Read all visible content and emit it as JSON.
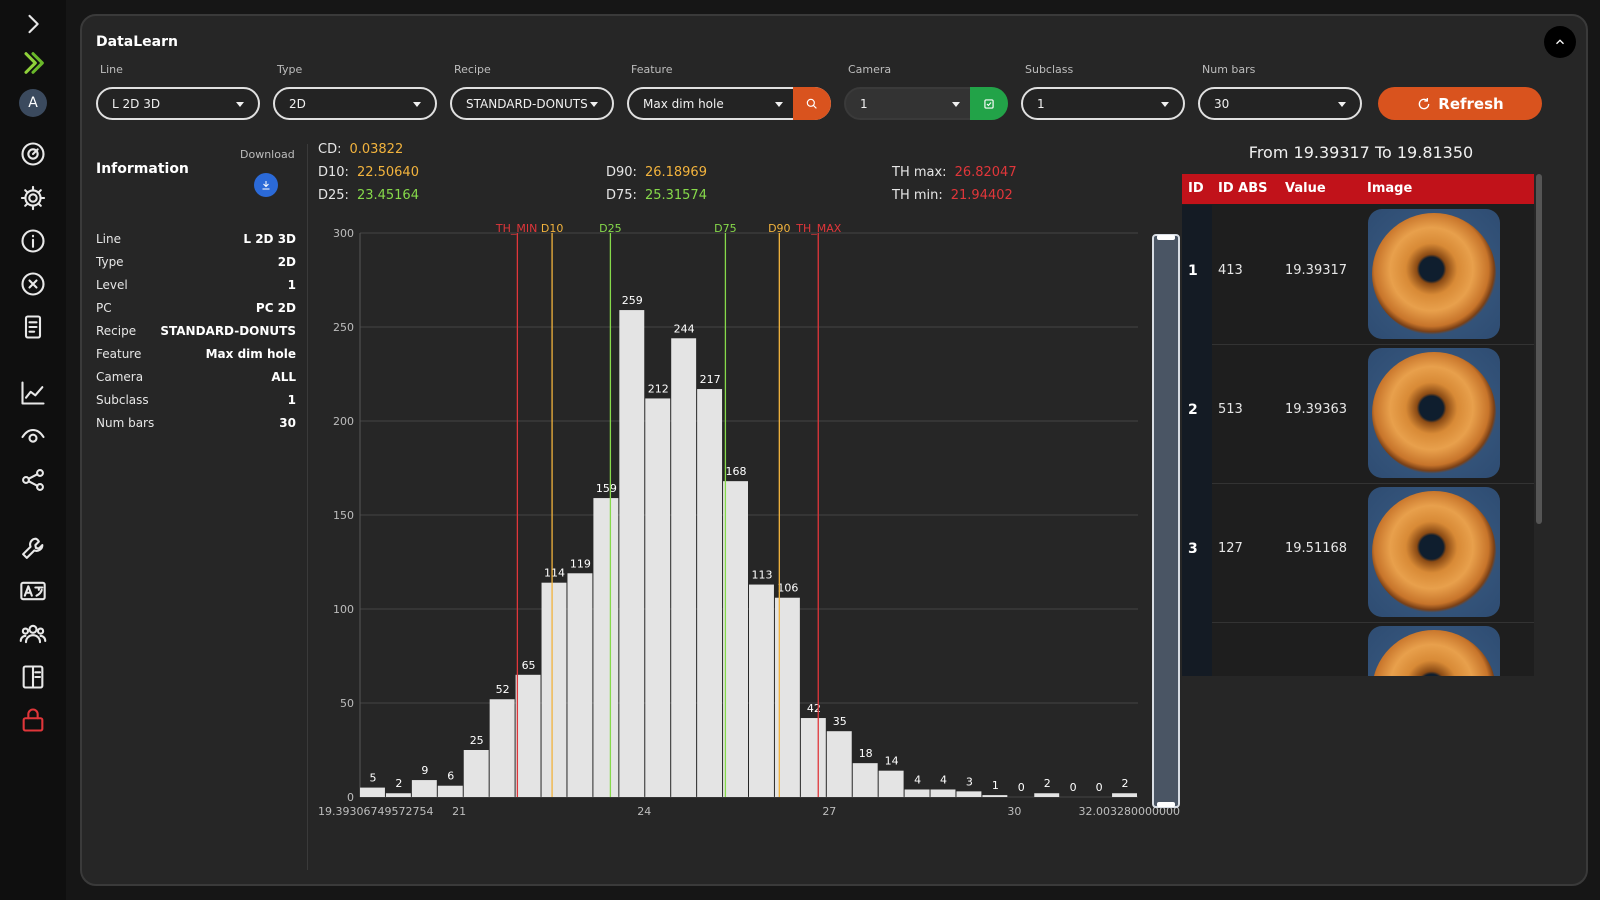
{
  "app": {
    "title": "DataLearn"
  },
  "filters": [
    {
      "label": "Line",
      "value": "L 2D 3D"
    },
    {
      "label": "Type",
      "value": "2D"
    },
    {
      "label": "Recipe",
      "value": "STANDARD-DONUTS"
    },
    {
      "label": "Feature",
      "value": "Max dim hole"
    },
    {
      "label": "Camera",
      "value": "1"
    },
    {
      "label": "Subclass",
      "value": "1"
    },
    {
      "label": "Num bars",
      "value": "30"
    }
  ],
  "refresh_label": "Refresh",
  "info": {
    "title": "Information",
    "download_label": "Download",
    "rows": [
      {
        "key": "Line",
        "value": "L 2D 3D"
      },
      {
        "key": "Type",
        "value": "2D"
      },
      {
        "key": "Level",
        "value": "1"
      },
      {
        "key": "PC",
        "value": "PC 2D"
      },
      {
        "key": "Recipe",
        "value": "STANDARD-DONUTS"
      },
      {
        "key": "Feature",
        "value": "Max dim hole"
      },
      {
        "key": "Camera",
        "value": "ALL"
      },
      {
        "key": "Subclass",
        "value": "1"
      },
      {
        "key": "Num bars",
        "value": "30"
      }
    ]
  },
  "stats": {
    "cd": {
      "label": "CD:",
      "value": "0.03822"
    },
    "d10": {
      "label": "D10:",
      "value": "22.50640"
    },
    "d25": {
      "label": "D25:",
      "value": "23.45164"
    },
    "d90": {
      "label": "D90:",
      "value": "26.18969"
    },
    "d75": {
      "label": "D75:",
      "value": "25.31574"
    },
    "th_max": {
      "label": "TH max:",
      "value": "26.82047"
    },
    "th_min": {
      "label": "TH min:",
      "value": "21.94402"
    }
  },
  "colors": {
    "orange": "#f2b33d",
    "green": "#86d94a",
    "red": "#e0363a",
    "accent": "#d9531e"
  },
  "chart_data": {
    "type": "bar",
    "values": [
      5,
      2,
      9,
      6,
      25,
      52,
      65,
      114,
      119,
      159,
      259,
      212,
      244,
      217,
      168,
      113,
      106,
      42,
      35,
      18,
      14,
      4,
      4,
      3,
      1,
      0,
      2,
      0,
      0,
      2
    ],
    "x_range": [
      19.39306749572754,
      32.00328
    ],
    "ylim": [
      0,
      300
    ],
    "y_ticks": [
      0,
      50,
      100,
      150,
      200,
      250,
      300
    ],
    "x_ticks": [
      {
        "value": 19.39306749572754,
        "label": "19.39306749572754"
      },
      {
        "value": 21,
        "label": "21"
      },
      {
        "value": 24,
        "label": "24"
      },
      {
        "value": 27,
        "label": "27"
      },
      {
        "value": 30,
        "label": "30"
      },
      {
        "value": 32.00328,
        "label": "32.003280000000"
      }
    ],
    "markers": [
      {
        "name": "TH_MIN",
        "x": 21.94402,
        "color": "#e0363a"
      },
      {
        "name": "D10",
        "x": 22.5064,
        "color": "#f2b33d"
      },
      {
        "name": "D25",
        "x": 23.45164,
        "color": "#86d94a"
      },
      {
        "name": "D75",
        "x": 25.31574,
        "color": "#86d94a"
      },
      {
        "name": "D90",
        "x": 26.18969,
        "color": "#f2b33d"
      },
      {
        "name": "TH_MAX",
        "x": 26.82047,
        "color": "#e0363a"
      }
    ],
    "grid": true
  },
  "table": {
    "range_label": "From 19.39317 To 19.81350",
    "headers": [
      "ID",
      "ID ABS",
      "Value",
      "Image"
    ],
    "rows": [
      {
        "id": "1",
        "id_abs": "413",
        "value": "19.39317",
        "image": "donut-image"
      },
      {
        "id": "2",
        "id_abs": "513",
        "value": "19.39363",
        "image": "donut-image"
      },
      {
        "id": "3",
        "id_abs": "127",
        "value": "19.51168",
        "image": "donut-image"
      }
    ]
  },
  "sidebar": {
    "user_initial": "A",
    "icons": [
      "expand-chevron-icon",
      "app-logo-icon",
      "user-avatar",
      "gauge-icon",
      "gear-icon",
      "info-icon",
      "close-circle-icon",
      "document-icon",
      "chart-line-icon",
      "eye-icon",
      "share-icon",
      "wrench-icon",
      "translate-icon",
      "users-icon",
      "book-icon",
      "lock-icon"
    ]
  }
}
